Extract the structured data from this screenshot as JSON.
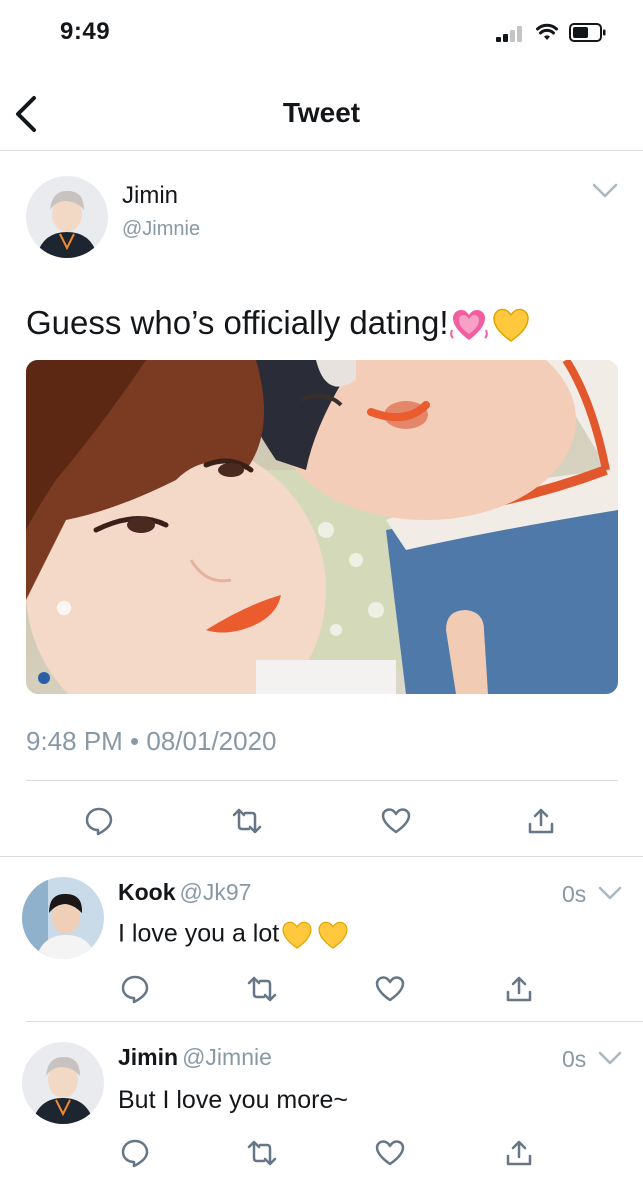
{
  "status_bar": {
    "time": "9:49"
  },
  "nav": {
    "title": "Tweet"
  },
  "main_tweet": {
    "name": "Jimin",
    "handle": "@Jimnie",
    "text": "Guess who’s officially dating!",
    "emojis": [
      "sparkling-heart",
      "yellow-heart"
    ],
    "timestamp": "9:48 PM • 08/01/2020"
  },
  "replies": [
    {
      "name": "Kook",
      "handle": "@Jk97",
      "time": "0s",
      "text": "I love you a lot",
      "emojis": [
        "yellow-heart",
        "yellow-heart"
      ]
    },
    {
      "name": "Jimin",
      "handle": "@Jimnie",
      "time": "0s",
      "text": "But I love you more~",
      "emojis": []
    }
  ],
  "icons": [
    "back-icon",
    "chevron-down-icon",
    "reply-icon",
    "retweet-icon",
    "like-icon",
    "share-icon"
  ],
  "colors": {
    "text": "#14171a",
    "secondary": "#8899a6",
    "divider": "#d8dde1",
    "icon": "#657786"
  }
}
